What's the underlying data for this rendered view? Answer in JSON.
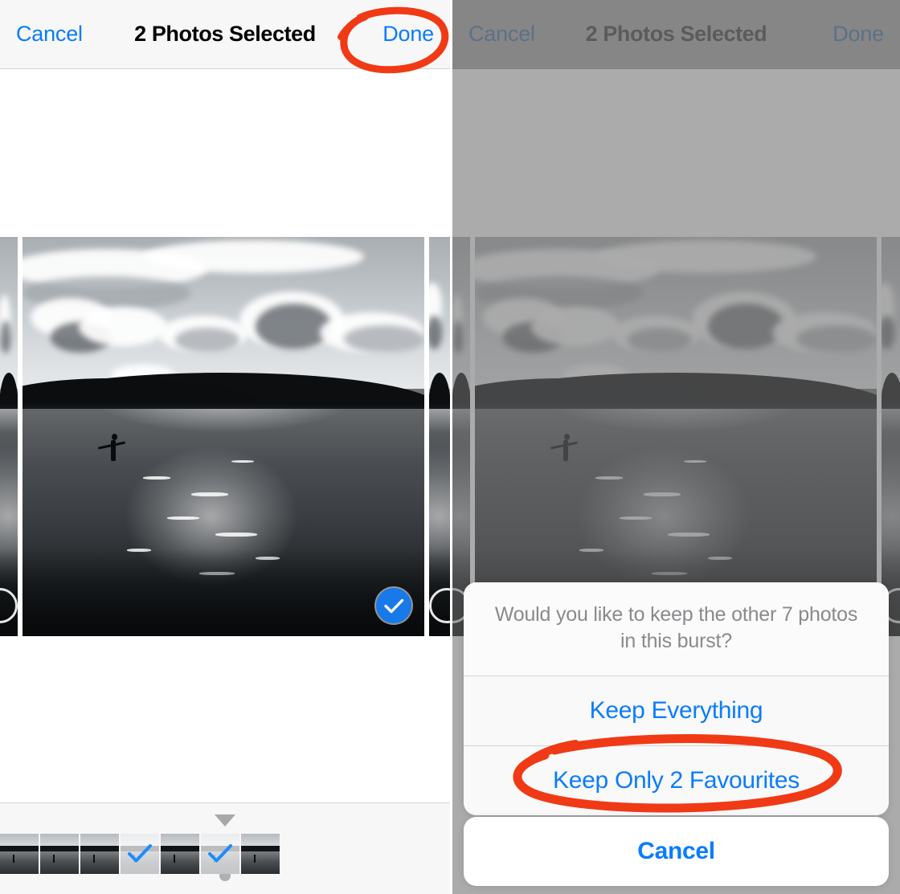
{
  "annotation": {
    "color": "#f03a15",
    "shape": "hand-drawn-oval",
    "targets": [
      "done-button",
      "keep-only-2-favourites-button"
    ]
  },
  "theme": {
    "accent_blue": "#0a7cff",
    "nav_background": "#f7f7f7",
    "title_color": "#000000",
    "dim_overlay": "#6e6e6e",
    "sheet_background": "#f8f8f8",
    "muted_text": "#8a8a8e"
  },
  "left_panel": {
    "name": "photo-selection-screen",
    "navbar": {
      "cancel_label": "Cancel",
      "title": "2 Photos Selected",
      "done_label": "Done"
    },
    "viewer": {
      "selected": true,
      "badge_icon": "check-circle-icon",
      "neighbor_badge_icon": "circle-outline-icon"
    },
    "filmstrip": {
      "marker_top_icon": "triangle-down-icon",
      "marker_bottom_icon": "dot-icon",
      "thumbnails": [
        {
          "index": 1,
          "selected": false
        },
        {
          "index": 2,
          "selected": false
        },
        {
          "index": 3,
          "selected": false
        },
        {
          "index": 4,
          "selected": true
        },
        {
          "index": 5,
          "selected": false
        },
        {
          "index": 6,
          "selected": true
        },
        {
          "index": 7,
          "selected": false
        }
      ]
    }
  },
  "right_panel": {
    "name": "burst-keep-confirmation-screen",
    "navbar": {
      "cancel_label": "Cancel",
      "title": "2 Photos Selected",
      "done_label": "Done"
    },
    "action_sheet": {
      "message": "Would you like to keep the other 7 photos in this burst?",
      "actions": [
        {
          "label": "Keep Everything",
          "name": "keep-everything-button"
        },
        {
          "label": "Keep Only 2 Favourites",
          "name": "keep-only-2-favourites-button"
        }
      ],
      "cancel_label": "Cancel"
    }
  }
}
